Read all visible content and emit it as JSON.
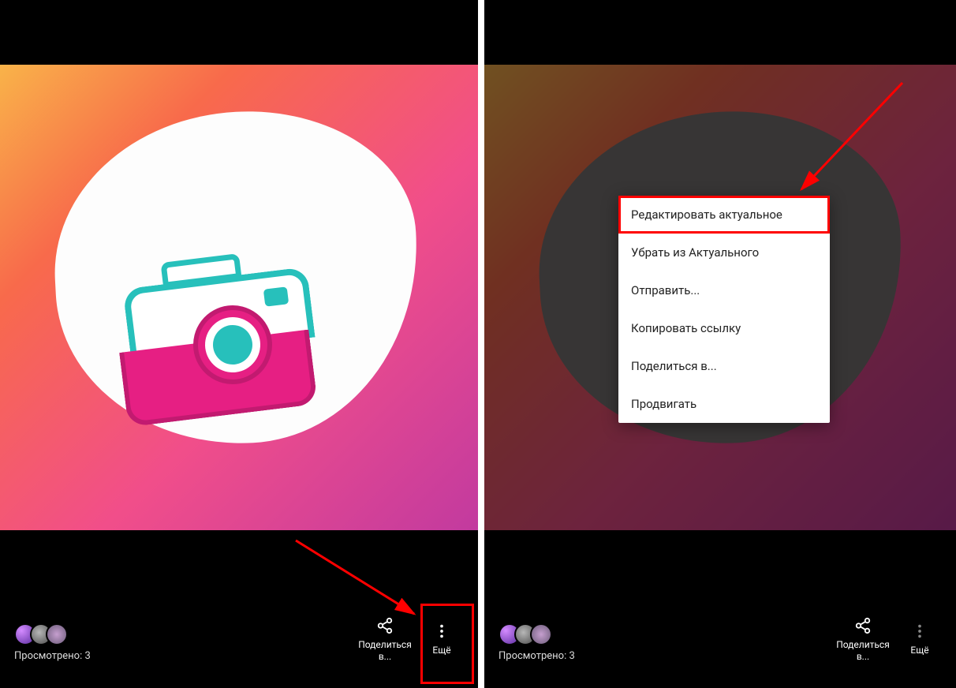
{
  "left": {
    "view_count_label": "Просмотрено: 3",
    "share_label": "Поделиться в...",
    "more_label": "Ещё"
  },
  "right": {
    "view_count_label": "Просмотрено: 3",
    "share_label": "Поделиться в...",
    "more_label": "Ещё",
    "menu": {
      "items": [
        "Редактировать актуальное",
        "Убрать из Актуального",
        "Отправить...",
        "Копировать ссылку",
        "Поделиться в...",
        "Продвигать"
      ]
    }
  }
}
